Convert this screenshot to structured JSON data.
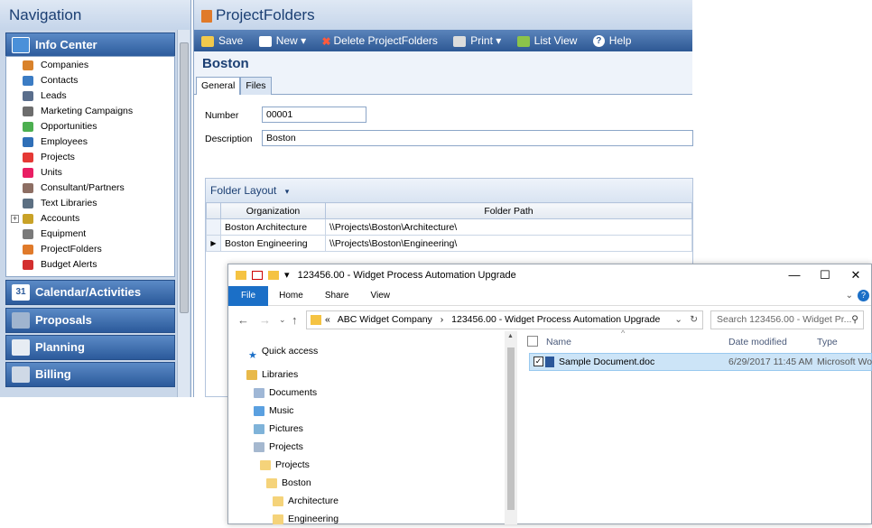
{
  "navigation": {
    "title": "Navigation",
    "groups": [
      {
        "label": "Info Center",
        "icon": "info-center-icon"
      },
      {
        "label": "Calendar/Activities",
        "icon": "calendar-icon"
      },
      {
        "label": "Proposals",
        "icon": "proposals-icon"
      },
      {
        "label": "Planning",
        "icon": "planning-icon"
      },
      {
        "label": "Billing",
        "icon": "billing-icon"
      }
    ],
    "items": [
      {
        "label": "Companies",
        "icon": "companies-icon"
      },
      {
        "label": "Contacts",
        "icon": "contacts-icon"
      },
      {
        "label": "Leads",
        "icon": "leads-icon"
      },
      {
        "label": "Marketing Campaigns",
        "icon": "marketing-campaigns-icon"
      },
      {
        "label": "Opportunities",
        "icon": "opportunities-icon"
      },
      {
        "label": "Employees",
        "icon": "employees-icon"
      },
      {
        "label": "Projects",
        "icon": "projects-icon"
      },
      {
        "label": "Units",
        "icon": "units-icon"
      },
      {
        "label": "Consultant/Partners",
        "icon": "consultant-partners-icon"
      },
      {
        "label": "Text Libraries",
        "icon": "text-libraries-icon"
      },
      {
        "label": "Accounts",
        "icon": "accounts-icon"
      },
      {
        "label": "Equipment",
        "icon": "equipment-icon"
      },
      {
        "label": "ProjectFolders",
        "icon": "project-folders-icon"
      },
      {
        "label": "Budget Alerts",
        "icon": "budget-alerts-icon"
      }
    ]
  },
  "project_folders": {
    "title": "ProjectFolders",
    "toolbar": {
      "save": "Save",
      "new": "New",
      "delete": "Delete ProjectFolders",
      "print": "Print",
      "list_view": "List View",
      "help": "Help"
    },
    "record_title": "Boston",
    "tabs": [
      "General",
      "Files"
    ],
    "fields": {
      "number_label": "Number",
      "number_value": "00001",
      "description_label": "Description",
      "description_value": "Boston"
    },
    "folder_layout": {
      "label": "Folder Layout",
      "columns": [
        "Organization",
        "Folder Path"
      ],
      "rows": [
        {
          "organization": "Boston Architecture",
          "path": "\\\\Projects\\Boston\\Architecture\\"
        },
        {
          "organization": "Boston Engineering",
          "path": "\\\\Projects\\Boston\\Engineering\\"
        }
      ]
    }
  },
  "explorer": {
    "title": "123456.00 - Widget Process Automation Upgrade",
    "ribbon": [
      "File",
      "Home",
      "Share",
      "View"
    ],
    "address": [
      "ABC Widget Company",
      "123456.00 - Widget Process Automation Upgrade"
    ],
    "address_prefix": "«",
    "search_placeholder": "Search 123456.00 - Widget Pr...",
    "tree": [
      {
        "label": "Quick access",
        "icon": "quick-access-star-icon"
      },
      {
        "label": "Libraries",
        "icon": "libraries-icon"
      },
      {
        "label": "Documents",
        "icon": "documents-icon"
      },
      {
        "label": "Music",
        "icon": "music-icon"
      },
      {
        "label": "Pictures",
        "icon": "pictures-icon"
      },
      {
        "label": "Projects",
        "icon": "projects-library-icon"
      },
      {
        "label": "Projects",
        "icon": "folder-icon"
      },
      {
        "label": "Boston",
        "icon": "folder-icon"
      },
      {
        "label": "Architecture",
        "icon": "folder-icon"
      },
      {
        "label": "Engineering",
        "icon": "folder-icon"
      }
    ],
    "columns": [
      "Name",
      "Date modified",
      "Type"
    ],
    "files": [
      {
        "name": "Sample Document.doc",
        "modified": "6/29/2017 11:45 AM",
        "type": "Microsoft Wo"
      }
    ]
  }
}
